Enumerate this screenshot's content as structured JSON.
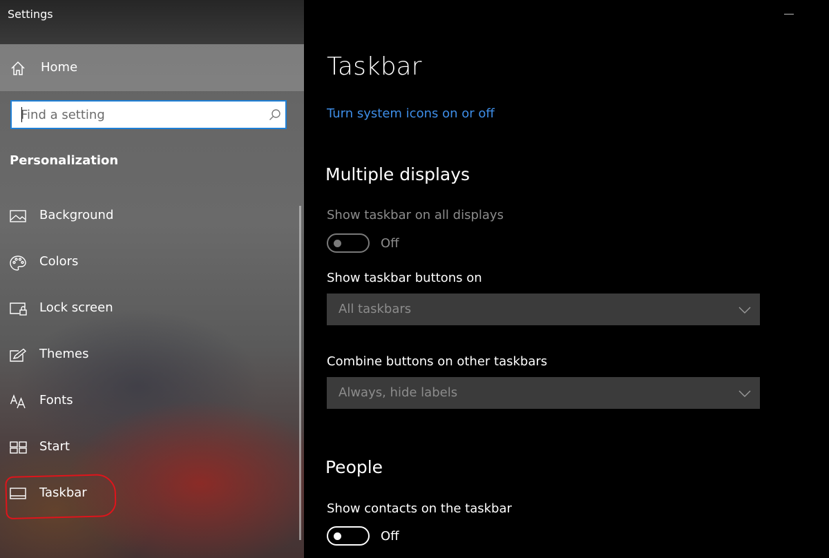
{
  "window": {
    "title": "Settings"
  },
  "sidebar": {
    "home_label": "Home",
    "search": {
      "placeholder": "Find a setting"
    },
    "section_title": "Personalization",
    "items": [
      {
        "label": "Background",
        "icon": "image-icon"
      },
      {
        "label": "Colors",
        "icon": "palette-icon"
      },
      {
        "label": "Lock screen",
        "icon": "lock-screen-icon"
      },
      {
        "label": "Themes",
        "icon": "themes-icon"
      },
      {
        "label": "Fonts",
        "icon": "fonts-icon"
      },
      {
        "label": "Start",
        "icon": "start-icon"
      },
      {
        "label": "Taskbar",
        "icon": "taskbar-icon",
        "selected": true
      }
    ]
  },
  "main": {
    "title": "Taskbar",
    "link": "Turn system icons on or off",
    "multiple_displays": {
      "heading": "Multiple displays",
      "show_all_label": "Show taskbar on all displays",
      "show_all_state": "Off",
      "buttons_on_label": "Show taskbar buttons on",
      "buttons_on_value": "All taskbars",
      "combine_label": "Combine buttons on other taskbars",
      "combine_value": "Always, hide labels"
    },
    "people": {
      "heading": "People",
      "contacts_label": "Show contacts on the taskbar",
      "contacts_state": "Off"
    }
  },
  "colors": {
    "accent": "#1e7fd6",
    "link": "#3e8ee8",
    "annotation": "#e0141b"
  }
}
